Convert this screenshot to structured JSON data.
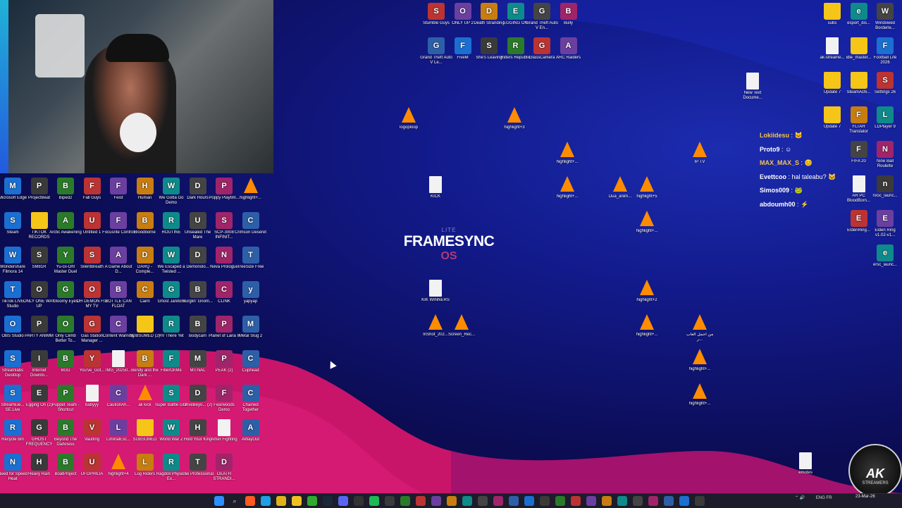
{
  "colors": {
    "bg": "#0b0c52",
    "wave": "#c8156a",
    "vlc": "#ff8c00",
    "folder": "#f5c518",
    "accent": "#1ce4a6"
  },
  "left_icons": [
    [
      "Microsoft Edge",
      "ProjectBeat",
      "Biped2",
      "Fall Guys",
      "Feist",
      "Human",
      "We Gotta Go Demo",
      "Dark Hours",
      "Poppy Playtim...",
      "highlight+..."
    ],
    [
      "Steam",
      "TIKTOK RECORDS",
      "Arctic Awakening",
      "Untitled 1",
      "Focusrite Control",
      "Bloodborne",
      "ROUTINE",
      "Unsealed The Mare",
      "SCP-3008 INFINIT...",
      "Crimson Deseret"
    ],
    [
      "Wondershare Filmora 14",
      "SM81R",
      "Yu-Gi-Oh! Master Duel",
      "SilentBreath",
      "A Game About D...",
      "DARQ - Comple...",
      "We Escaped a Twisted ...",
      "Demonolo...",
      "Neva Prologue",
      "TreeSize Free"
    ],
    [
      "TikTok LIVE Studio",
      "ONLY ONE WAY UP",
      "Gloomy Eyes",
      "OH DEMON FIX MY TV",
      "BOTTLE CAN FLOAT",
      "Cairn",
      "Ghost Janitors",
      "Burglin' Gnom...",
      "CLINK",
      "yapyap"
    ],
    [
      "OBS Studio",
      "PARTY ANIMM",
      "Only Climb Better To...",
      "Gas Station Manager ...",
      "Content Warning",
      "SUBSUMED (2)",
      "RV There Yet",
      "Bodycam",
      "Planet of Lana II",
      "Metal Slug 2"
    ],
    [
      "Streamlabs Desktop",
      "Internet Downlo...",
      "BGG",
      "You've_Got...",
      "IMG_20250...",
      "Bendy and the Dark ...",
      "FitierOnMe",
      "MITNAL",
      "PEAK (2)",
      "Cuphead"
    ],
    [
      "StreamEle... SE.Live",
      "Egging On (2)",
      "Puppet Team - Shortcut",
      "babyyy",
      "CautionAh...",
      "ali kick",
      "Super Battle Golf",
      "DriveBeyo... (2)",
      "Fearwoods Demo",
      "Chained Together"
    ],
    [
      "Recycle Bin",
      "GHOST FREQUENCY",
      "Beyond The Darkness",
      "Vaulting",
      "LiminalEsc...",
      "SUBSUMED",
      "World War Z",
      "Hold Your King",
      "Amer Fighting",
      "AWayOut"
    ],
    [
      "Need for Speed Heat",
      "Heavy Rain",
      "BoatProject",
      "UFOPHILIA",
      "highlight+4",
      "Log Riders",
      "Ragdoll Physics Ex...",
      "The Professional",
      "DEATH STRANDI..."
    ]
  ],
  "top_icons": [
    [
      "Stumble Guys",
      "ONLY UP 2",
      "Death Stranding",
      "EGGING ON",
      "Grand Theft Auto V En...",
      "Bully"
    ],
    [
      "Grand Theft Auto V Le...",
      "FiveM",
      "She's Leaving",
      "Riders Republic",
      "GlassCamera",
      "ARC Raiders"
    ]
  ],
  "mid_icons": {
    "logoploop": "logoploop",
    "highlight3": "highlight+3",
    "hl_a": "highlight+...",
    "iptv": "IP TV",
    "kick": "KICK",
    "hl_b": "highlight+...",
    "dua": "Dua_anim...",
    "hl5": "highlight+5",
    "hl_c": "highlight+...",
    "kikwin": "KIK WINNERS",
    "hl2": "highlight+2",
    "inshot": "InShot_202...",
    "screenrec": "Screen_Rec...",
    "hl_d": "highlight+...",
    "arabic": "من أجمل ألعاب ر...",
    "hl_e": "highlight+...",
    "hl_f": "highlight+...",
    "newtxt": "New Text Docume...",
    "emotes": "emotes"
  },
  "right_icons": [
    [
      "subs",
      "esport_dis...",
      "Windowed Borderle..."
    ],
    [
      "ak-streame...",
      "idle_master...",
      "Football Life 2026"
    ],
    [
      "Update 7",
      "SteamAchi...",
      "Settings 26"
    ],
    [
      "Update 7",
      "FLTAH Translator",
      "LDPlayer 9"
    ],
    [
      "FIFA 20",
      "Nine Ball Roulette"
    ],
    [
      "AR PC BloodBorn...",
      "nxsc_launc..."
    ],
    [
      "EldenRing...",
      "Elden Ring v1.02-v1..."
    ],
    [
      "ersc_launc..."
    ]
  ],
  "framesync": {
    "lite": "LITE",
    "name": "FRAMESYNC",
    "os": "OS"
  },
  "chat": [
    {
      "user": "Lokiidesu",
      "sep": " :",
      "msg": "🐱",
      "color": "#f6c544"
    },
    {
      "user": "Proto9",
      "sep": " :",
      "msg": "☺",
      "color": "#ffffff"
    },
    {
      "user": "MAX_MAX_S",
      "sep": " :",
      "msg": "😊",
      "color": "#f6c544"
    },
    {
      "user": "Evettcoo",
      "sep": " :",
      "msg": " hal taleabu? 🐱",
      "color": "#ffffff"
    },
    {
      "user": "Simos009",
      "sep": " :",
      "msg": "🐸",
      "color": "#ffffff"
    },
    {
      "user": "abdoumh00",
      "sep": " :",
      "msg": "⚡",
      "color": "#ffffff"
    }
  ],
  "tray": {
    "lang": "ENG FR",
    "date": "23-Mar-26"
  },
  "logo": {
    "ak": "AK",
    "sub": "STREAMERS"
  }
}
